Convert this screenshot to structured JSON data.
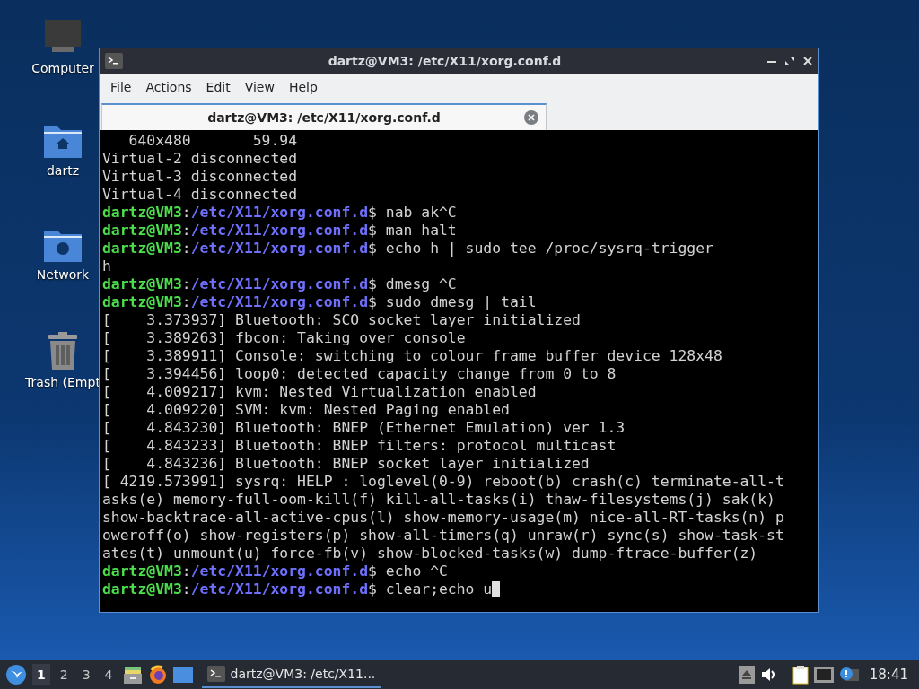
{
  "desktop_icons": [
    {
      "kind": "computer",
      "label": "Computer"
    },
    {
      "kind": "home",
      "label": "dartz"
    },
    {
      "kind": "network",
      "label": "Network"
    },
    {
      "kind": "trash",
      "label": "Trash (Empt"
    }
  ],
  "window": {
    "title": "dartz@VM3: /etc/X11/xorg.conf.d",
    "menu": [
      "File",
      "Actions",
      "Edit",
      "View",
      "Help"
    ],
    "tabs": [
      {
        "label": "dartz@VM3: /etc/X11/xorg.conf.d",
        "selected": true
      }
    ],
    "terminal_lines": [
      {
        "kind": "output",
        "text": "   640x480       59.94"
      },
      {
        "kind": "output",
        "text": "Virtual-2 disconnected"
      },
      {
        "kind": "output",
        "text": "Virtual-3 disconnected"
      },
      {
        "kind": "output",
        "text": "Virtual-4 disconnected"
      },
      {
        "kind": "prompt",
        "user": "dartz@VM3",
        "colon": ":",
        "path": "/etc/X11/xorg.conf.d",
        "command": "$ nab ak^C",
        "cursor": false
      },
      {
        "kind": "prompt",
        "user": "dartz@VM3",
        "colon": ":",
        "path": "/etc/X11/xorg.conf.d",
        "command": "$ man halt",
        "cursor": false
      },
      {
        "kind": "prompt",
        "user": "dartz@VM3",
        "colon": ":",
        "path": "/etc/X11/xorg.conf.d",
        "command": "$ echo h | sudo tee /proc/sysrq-trigger",
        "cursor": false
      },
      {
        "kind": "output",
        "text": "h"
      },
      {
        "kind": "prompt",
        "user": "dartz@VM3",
        "colon": ":",
        "path": "/etc/X11/xorg.conf.d",
        "command": "$ dmesg ^C",
        "cursor": false
      },
      {
        "kind": "prompt",
        "user": "dartz@VM3",
        "colon": ":",
        "path": "/etc/X11/xorg.conf.d",
        "command": "$ sudo dmesg | tail",
        "cursor": false
      },
      {
        "kind": "output",
        "text": "[    3.373937] Bluetooth: SCO socket layer initialized"
      },
      {
        "kind": "output",
        "text": "[    3.389263] fbcon: Taking over console"
      },
      {
        "kind": "output",
        "text": "[    3.389911] Console: switching to colour frame buffer device 128x48"
      },
      {
        "kind": "output",
        "text": "[    3.394456] loop0: detected capacity change from 0 to 8"
      },
      {
        "kind": "output",
        "text": "[    4.009217] kvm: Nested Virtualization enabled"
      },
      {
        "kind": "output",
        "text": "[    4.009220] SVM: kvm: Nested Paging enabled"
      },
      {
        "kind": "output",
        "text": "[    4.843230] Bluetooth: BNEP (Ethernet Emulation) ver 1.3"
      },
      {
        "kind": "output",
        "text": "[    4.843233] Bluetooth: BNEP filters: protocol multicast"
      },
      {
        "kind": "output",
        "text": "[    4.843236] Bluetooth: BNEP socket layer initialized"
      },
      {
        "kind": "output",
        "text": "[ 4219.573991] sysrq: HELP : loglevel(0-9) reboot(b) crash(c) terminate-all-t"
      },
      {
        "kind": "output",
        "text": "asks(e) memory-full-oom-kill(f) kill-all-tasks(i) thaw-filesystems(j) sak(k)"
      },
      {
        "kind": "output",
        "text": "show-backtrace-all-active-cpus(l) show-memory-usage(m) nice-all-RT-tasks(n) p"
      },
      {
        "kind": "output",
        "text": "oweroff(o) show-registers(p) show-all-timers(q) unraw(r) sync(s) show-task-st"
      },
      {
        "kind": "output",
        "text": "ates(t) unmount(u) force-fb(v) show-blocked-tasks(w) dump-ftrace-buffer(z)"
      },
      {
        "kind": "prompt",
        "user": "dartz@VM3",
        "colon": ":",
        "path": "/etc/X11/xorg.conf.d",
        "command": "$ echo ^C",
        "cursor": false
      },
      {
        "kind": "prompt",
        "user": "dartz@VM3",
        "colon": ":",
        "path": "/etc/X11/xorg.conf.d",
        "command": "$ clear;echo u",
        "cursor": true
      }
    ]
  },
  "taskbar": {
    "workspaces": [
      {
        "label": "1",
        "selected": true
      },
      {
        "label": "2",
        "selected": false
      },
      {
        "label": "3",
        "selected": false
      },
      {
        "label": "4",
        "selected": false
      }
    ],
    "task": {
      "label": "dartz@VM3: /etc/X11..."
    },
    "clock": "18:41"
  }
}
